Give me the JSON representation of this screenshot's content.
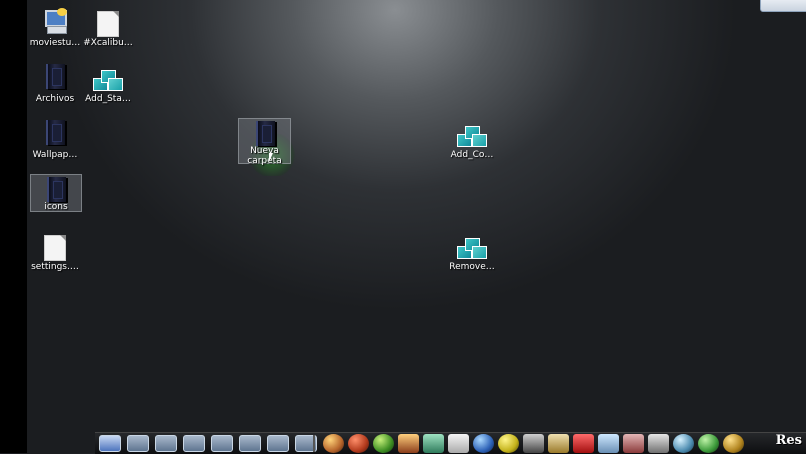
{
  "desktop": {
    "icons": [
      {
        "name": "movie-studio",
        "label": "moviestu…",
        "glyph": "computer-icon"
      },
      {
        "name": "xcalibur-file",
        "label": "#Xcalibu…",
        "glyph": "document-icon"
      },
      {
        "name": "archivos-folder",
        "label": "Archivos",
        "glyph": "book-folder-icon"
      },
      {
        "name": "add-start",
        "label": "Add_Sta…",
        "glyph": "registry-icon"
      },
      {
        "name": "wallpaper-folder",
        "label": "Wallpap…",
        "glyph": "book-folder-icon"
      },
      {
        "name": "nueva-carpeta",
        "label": "Nueva carpeta",
        "glyph": "book-folder-icon"
      },
      {
        "name": "add-co",
        "label": "Add_Co…",
        "glyph": "registry-icon"
      },
      {
        "name": "icons-folder",
        "label": "icons",
        "glyph": "book-folder-icon"
      },
      {
        "name": "settings-file",
        "label": "settings.…",
        "glyph": "document-icon"
      },
      {
        "name": "remove",
        "label": "Remove…",
        "glyph": "registry-icon"
      }
    ]
  },
  "taskbar": {
    "quick_launch_icons": [
      "finder-icon",
      "folder-icon",
      "folder-icon",
      "folder-icon",
      "folder-icon",
      "folder-icon",
      "folder-icon",
      "folder-icon"
    ],
    "dock_icons": [
      "app-icon-1",
      "app-icon-2",
      "app-icon-3",
      "app-icon-4",
      "app-icon-5",
      "app-icon-6",
      "app-icon-7",
      "app-icon-8",
      "app-icon-9",
      "app-icon-10",
      "app-icon-11",
      "app-icon-12",
      "app-icon-13",
      "app-icon-14",
      "app-icon-15",
      "app-icon-16",
      "app-icon-17",
      "app-icon-18"
    ],
    "res_label": "Res"
  },
  "colors": {
    "desktop_top": "#8a8e92",
    "desktop_bottom": "#1b1d20",
    "selection": "#787d82",
    "drag_highlight": "#286e28"
  }
}
